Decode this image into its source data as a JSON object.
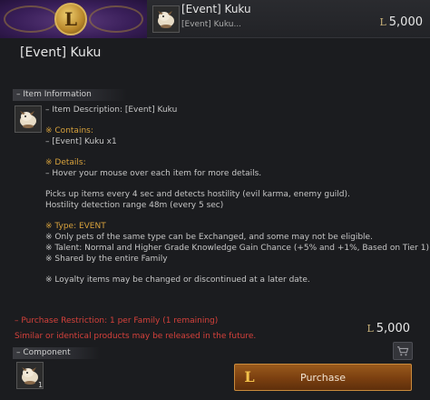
{
  "header": {
    "item_title": "[Event] Kuku",
    "item_subtitle": "[Event] Kuku...",
    "currency_symbol": "L",
    "price": "5,000"
  },
  "title": "[Event] Kuku",
  "item_information": {
    "section_label": "Item Information",
    "description": "– Item Description: [Event] Kuku",
    "contains_label": "※ Contains:",
    "contains_item": "– [Event] Kuku x1",
    "details_label": "※ Details:",
    "details_hover": "– Hover your mouse over each item for more details.",
    "pickup_line": "Picks up items every 4 sec and detects hostility (evil karma, enemy guild).",
    "hostility_line": "Hostility detection range 48m (every 5 sec)",
    "type_line": "※ Type: EVENT",
    "exchange_line": "※ Only pets of the same type can be Exchanged, and some may not be eligible.",
    "talent_line": "※ Talent: Normal and Higher Grade Knowledge Gain Chance (+5% and +1%, Based on Tier 1)",
    "shared_line": "※ Shared by the entire Family",
    "loyalty_line": "※ Loyalty items may be changed or discontinued at a later date."
  },
  "purchase_restriction": "– Purchase Restriction: 1 per Family (1 remaining)",
  "similar_notice": "Similar or identical products may be released in the future.",
  "total": {
    "currency_symbol": "L",
    "price": "5,000"
  },
  "purchase_button": {
    "label": "Purchase",
    "logo": "L"
  },
  "component": {
    "section_label": "Component",
    "count": "1"
  },
  "colors": {
    "gold_text": "#d8a23c",
    "red_text": "#d5413b",
    "button": "#8a4a14"
  },
  "icons": [
    "shopping-cart-icon",
    "kuku-pet-icon",
    "loyalty-coin-icon"
  ]
}
